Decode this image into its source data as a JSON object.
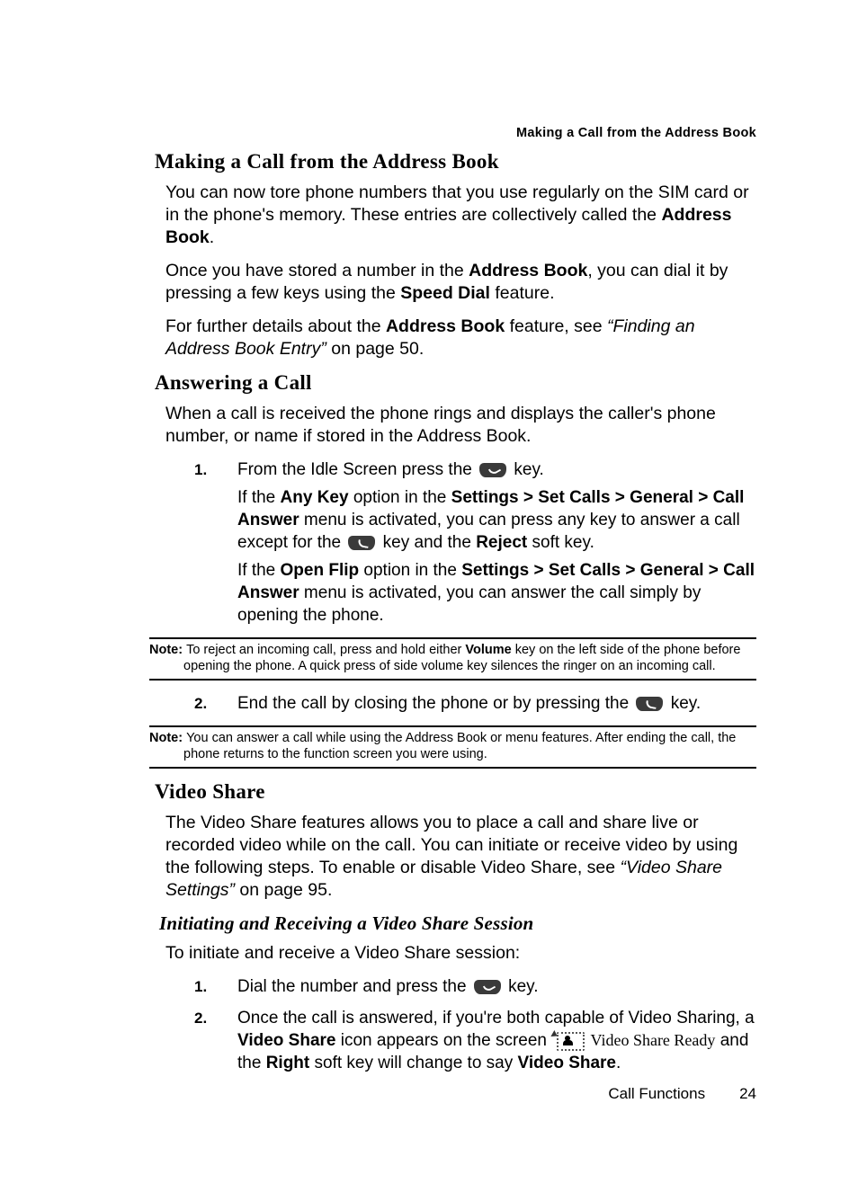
{
  "header": {
    "running_title": "Making a Call from the Address Book"
  },
  "sections": {
    "making_call": {
      "title": "Making a Call from the Address Book",
      "p1_a": "You can now tore phone numbers that you use regularly on the SIM card or in the phone's memory. These entries are collectively called the ",
      "p1_b": "Address Book",
      "p1_c": ".",
      "p2_a": "Once you have stored a number in the ",
      "p2_b": "Address Book",
      "p2_c": ", you can dial it by pressing a few keys using the ",
      "p2_d": "Speed Dial",
      "p2_e": " feature.",
      "p3_a": "For further details about the ",
      "p3_b": "Address Book",
      "p3_c": " feature, see ",
      "p3_d": "“Finding an Address Book Entry”",
      "p3_e": " on page 50."
    },
    "answering": {
      "title": "Answering a Call",
      "p1": "When a call is received the phone rings and displays the caller's phone number, or name if stored in the Address Book.",
      "steps": {
        "s1": {
          "num": "1.",
          "line1_a": "From the Idle Screen press the ",
          "line1_b": " key.",
          "line2_a": "If the ",
          "line2_b": "Any Key",
          "line2_c": " option in the ",
          "line2_d": "Settings > Set Calls > General > Call Answer",
          "line2_e": " menu is activated, you can press any key to answer a call except for the ",
          "line2_f": " key and the ",
          "line2_g": "Reject",
          "line2_h": " soft key.",
          "line3_a": "If the ",
          "line3_b": "Open Flip",
          "line3_c": " option in the ",
          "line3_d": "Settings > Set Calls > General > Call Answer",
          "line3_e": " menu is activated, you can answer the call simply by opening the phone."
        },
        "s2": {
          "num": "2.",
          "line1_a": "End the call by closing the phone or by pressing the ",
          "line1_b": " key."
        }
      },
      "note1": {
        "label": "Note: ",
        "body_a": "To reject an incoming call, press and hold either ",
        "body_b": "Volume",
        "body_c": " key on the left side of the phone before opening the phone. A quick press of side volume key silences the ringer on an incoming call."
      },
      "note2": {
        "label": "Note: ",
        "body": "You can answer a call while using the Address Book or menu features. After ending the call, the phone returns to the function screen you were using."
      }
    },
    "video_share": {
      "title": "Video Share",
      "p1_a": "The Video Share features allows you to place a call and share live or recorded video while on the call.  You can initiate or receive video by using the following steps.  To enable or disable Video Share, see ",
      "p1_b": "“Video Share Settings”",
      "p1_c": " on page 95.",
      "subsection_title": "Initiating and Receiving a Video Share Session",
      "p2": "To initiate and receive a Video Share session:",
      "steps": {
        "s1": {
          "num": "1.",
          "a": "Dial the number and press the ",
          "b": " key."
        },
        "s2": {
          "num": "2.",
          "a": "Once the call is answered, if you're both capable of Video Sharing, a ",
          "b": "Video Share",
          "c": " icon appears on the screen ",
          "d": "Video Share Ready",
          "e": "  and the ",
          "f": "Right",
          "g": " soft key will change to say ",
          "h": "Video Share",
          "i": "."
        }
      }
    }
  },
  "footer": {
    "section": "Call Functions",
    "page": "24"
  }
}
